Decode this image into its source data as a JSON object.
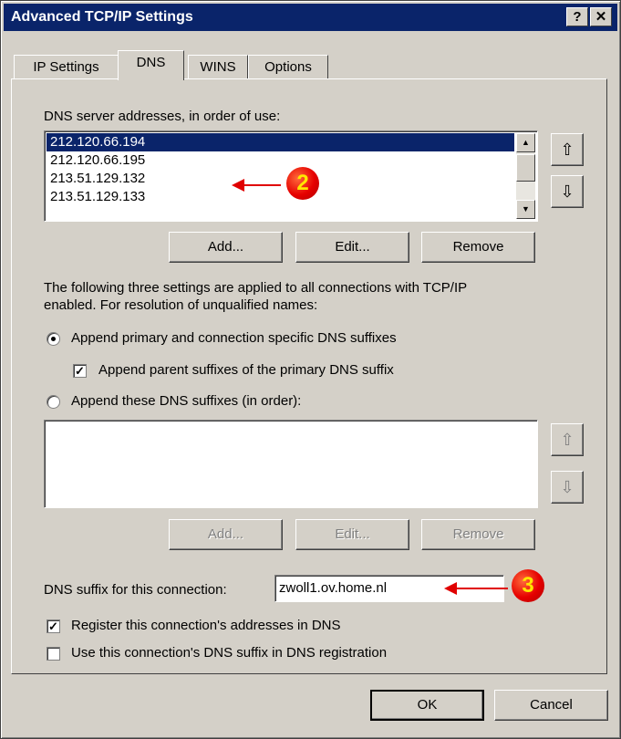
{
  "window": {
    "title": "Advanced TCP/IP Settings",
    "help_label": "?",
    "close_label": "✕"
  },
  "tabs": [
    {
      "label": "IP Settings"
    },
    {
      "label": "DNS",
      "active": true
    },
    {
      "label": "WINS"
    },
    {
      "label": "Options"
    }
  ],
  "dns_servers": {
    "label": "DNS server addresses, in order of use:",
    "items": [
      "212.120.66.194",
      "212.120.66.195",
      "213.51.129.132",
      "213.51.129.133"
    ],
    "selected_index": 0,
    "add_label": "Add...",
    "edit_label": "Edit...",
    "remove_label": "Remove"
  },
  "resolution": {
    "info_line1": "The following three settings are applied to all connections with TCP/IP",
    "info_line2": "enabled. For resolution of unqualified names:",
    "radio_primary_label": "Append primary and connection specific DNS suffixes",
    "radio_primary_checked": true,
    "check_parent_label": "Append parent suffixes of the primary DNS suffix",
    "check_parent_checked": true,
    "radio_these_label": "Append these DNS suffixes (in order):",
    "radio_these_checked": false,
    "suffixes_items": [],
    "add_label": "Add...",
    "edit_label": "Edit...",
    "remove_label": "Remove"
  },
  "connection_suffix": {
    "label": "DNS suffix for this connection:",
    "value": "zwoll1.ov.home.nl"
  },
  "register": {
    "register_label": "Register this connection's addresses in DNS",
    "register_checked": true,
    "use_suffix_label": "Use this connection's DNS suffix in DNS registration",
    "use_suffix_checked": false
  },
  "footer": {
    "ok_label": "OK",
    "cancel_label": "Cancel"
  },
  "annotations": [
    {
      "number": "2",
      "color": "#e00000"
    },
    {
      "number": "3",
      "color": "#e00000"
    }
  ],
  "icons": {
    "move_up": "⇧",
    "move_down": "⇩",
    "scroll_up": "▲",
    "scroll_down": "▼"
  }
}
